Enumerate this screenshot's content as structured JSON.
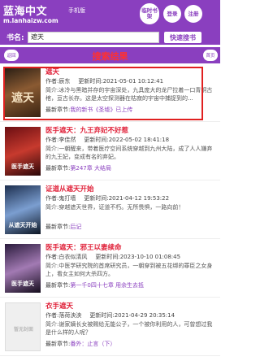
{
  "header": {
    "site_name": "蓝海中文",
    "site_sub": "手机版",
    "site_url": "m.lanhaizw.com",
    "history_label": "临时书架",
    "login_label": "登录",
    "register_label": "注册"
  },
  "search": {
    "label": "书名:",
    "value": "遮天",
    "button_label": "快速搜书"
  },
  "results_bar": {
    "back_label": "返回",
    "title": "搜索结果",
    "home_label": "首页"
  },
  "results": [
    {
      "title": "遮天",
      "author_label": "作者:",
      "author": "辰东",
      "updated_label": "更新时间:",
      "updated": "2021-05-01 10:12:41",
      "intro_label": "简介:",
      "intro": "冰冷与黑暗并存的宇宙深处，九具庞大的龙尸拉着一口青铜古棺，亘古长存。这是太空探测器在枯寂的宇宙中捕捉到的...",
      "latest_label": "最新章节:",
      "latest": "我的新书《圣墟》已上传",
      "cover_text": "遮天"
    },
    {
      "title": "医手遮天：九王弃妃不好惹",
      "author_label": "作者:",
      "author": "李佳然",
      "updated_label": "更新时间:",
      "updated": "2022-05-02 18:41:18",
      "intro_label": "简介:",
      "intro": "一朝醒来，带着医疗空间系统穿越到九州大陆，成了人人嫌弃的九王妃，变成有名的弃妃。",
      "latest_label": "最新章节:",
      "latest": "第247章 大结局",
      "cover_text": "医手遮天"
    },
    {
      "title": "证道从遮天开始",
      "author_label": "作者:",
      "author": "鬼打墙",
      "updated_label": "更新时间:",
      "updated": "2021-04-12 19:53:22",
      "intro_label": "简介:",
      "intro": "穿越遮天世界，证道不朽。无所畏惧，一路向前！",
      "latest_label": "最新章节:",
      "latest": "后记",
      "cover_text": "从遮天开始"
    },
    {
      "title": "医手遮天：邪王以妻续命",
      "author_label": "作者:",
      "author": "白衣似清风",
      "updated_label": "更新时间:",
      "updated": "2023-10-10 01:08:45",
      "intro_label": "简介:",
      "intro": "中医学研究院的首席研究员，一朝穿到被五花绑的罪臣之女身上，看女主如何大杀四方。",
      "latest_label": "最新章节:",
      "latest": "第一千0四十七章 用余生去抵",
      "cover_text": "医手遮天"
    },
    {
      "title": "衣手遮天",
      "author_label": "作者:",
      "author": "落荷泱泱",
      "updated_label": "更新时间:",
      "updated": "2021-04-29 20:35:14",
      "intro_label": "简介:",
      "intro": "谢家嫡长女被赐给无能公子，一个被你利用的人，可曾想过我是什么样的人呢？",
      "latest_label": "最新章节:",
      "latest": "番外：止言（下）",
      "cover_text": "暂无封面"
    }
  ],
  "colors": {
    "brand": "#8a3fbf",
    "title_red": "#e0223a",
    "highlight": "#e02020"
  }
}
